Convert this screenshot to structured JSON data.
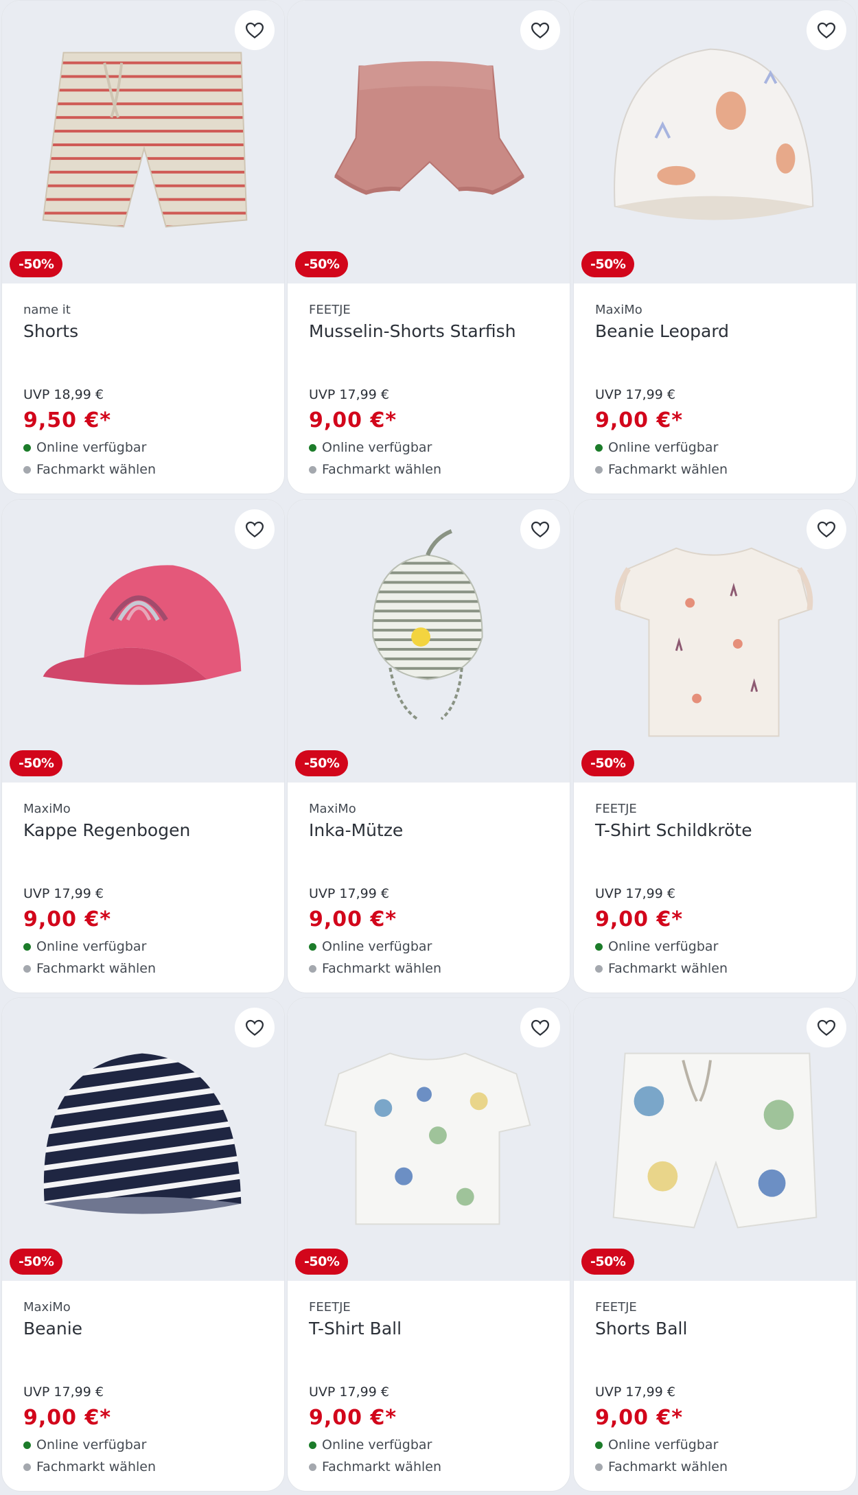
{
  "colors": {
    "sale_red": "#d2061b",
    "available_green": "#1c7c2a",
    "store_grey": "#a4a8ae",
    "image_bg": "#e9ecf2"
  },
  "icons": {
    "favorite": "heart-outline-icon"
  },
  "products": [
    {
      "brand": "name it",
      "title": "Shorts",
      "badge": "-50%",
      "uvp": "UVP 18,99 €",
      "price": "9,50 €*",
      "availability": "Online verfügbar",
      "store": "Fachmarkt wählen",
      "image": "striped shorts beige/red"
    },
    {
      "brand": "FEETJE",
      "title": "Musselin-Shorts Starfish",
      "badge": "-50%",
      "uvp": "UVP 17,99 €",
      "price": "9,00 €*",
      "availability": "Online verfügbar",
      "store": "Fachmarkt wählen",
      "image": "pink ruffle shorts"
    },
    {
      "brand": "MaxiMo",
      "title": "Beanie Leopard",
      "badge": "-50%",
      "uvp": "UVP 17,99 €",
      "price": "9,00 €*",
      "availability": "Online verfügbar",
      "store": "Fachmarkt wählen",
      "image": "white beanie with leopards"
    },
    {
      "brand": "MaxiMo",
      "title": "Kappe Regenbogen",
      "badge": "-50%",
      "uvp": "UVP 17,99 €",
      "price": "9,00 €*",
      "availability": "Online verfügbar",
      "store": "Fachmarkt wählen",
      "image": "pink cap with rainbow"
    },
    {
      "brand": "MaxiMo",
      "title": "Inka-Mütze",
      "badge": "-50%",
      "uvp": "UVP 17,99 €",
      "price": "9,00 €*",
      "availability": "Online verfügbar",
      "store": "Fachmarkt wählen",
      "image": "striped inka hat"
    },
    {
      "brand": "FEETJE",
      "title": "T-Shirt Schildkröte",
      "badge": "-50%",
      "uvp": "UVP 17,99 €",
      "price": "9,00 €*",
      "availability": "Online verfügbar",
      "store": "Fachmarkt wählen",
      "image": "cream t-shirt turtles"
    },
    {
      "brand": "MaxiMo",
      "title": "Beanie",
      "badge": "-50%",
      "uvp": "UVP 17,99 €",
      "price": "9,00 €*",
      "availability": "Online verfügbar",
      "store": "Fachmarkt wählen",
      "image": "navy striped beanie"
    },
    {
      "brand": "FEETJE",
      "title": "T-Shirt Ball",
      "badge": "-50%",
      "uvp": "UVP 17,99 €",
      "price": "9,00 €*",
      "availability": "Online verfügbar",
      "store": "Fachmarkt wählen",
      "image": "white t-shirt beach balls"
    },
    {
      "brand": "FEETJE",
      "title": "Shorts Ball",
      "badge": "-50%",
      "uvp": "UVP 17,99 €",
      "price": "9,00 €*",
      "availability": "Online verfügbar",
      "store": "Fachmarkt wählen",
      "image": "white shorts beach balls"
    }
  ]
}
